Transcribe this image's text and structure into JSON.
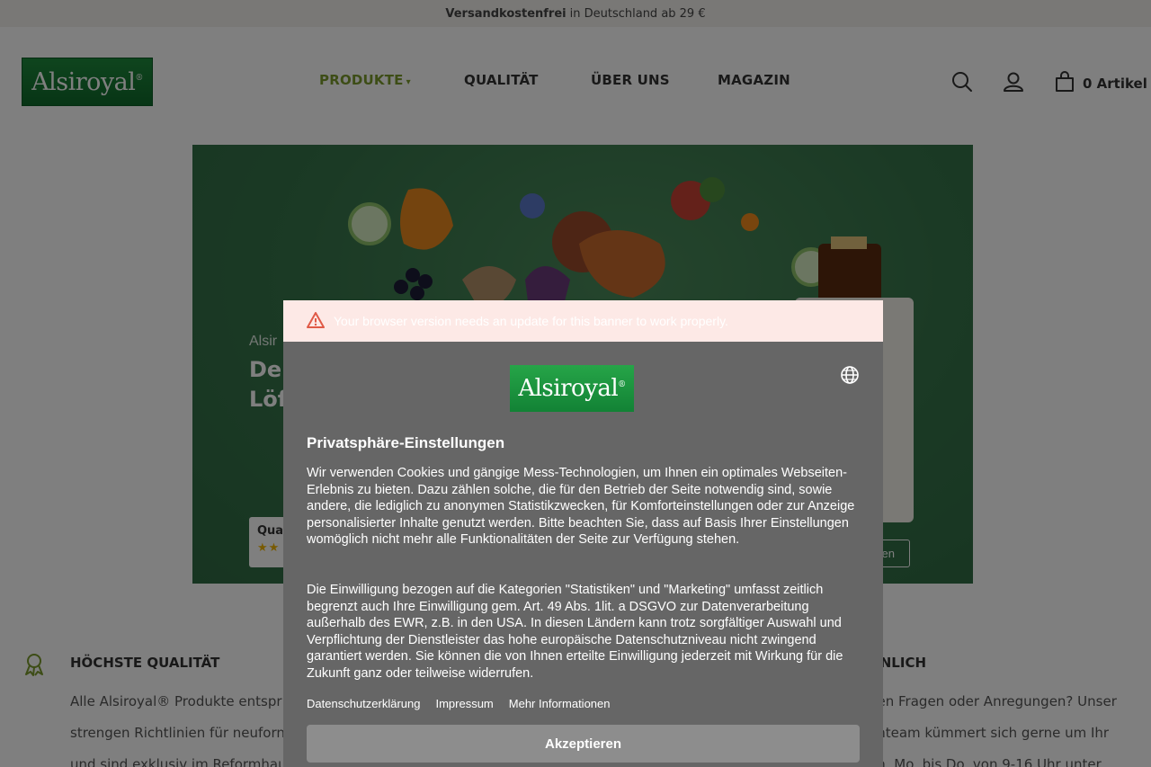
{
  "promo": {
    "bold": "Versandkostenfrei",
    "rest": "in Deutschland ab 29 €"
  },
  "header": {
    "logo_text": "Alsiroyal",
    "logo_reg": "®",
    "nav": [
      {
        "label": "PRODUKTE",
        "active": true,
        "caret": "▾"
      },
      {
        "label": "QUALITÄT"
      },
      {
        "label": "ÜBER UNS"
      },
      {
        "label": "MAGAZIN"
      }
    ],
    "icons": [
      "search-icon",
      "user-icon",
      "bag-icon"
    ],
    "cart_label": "0 Artikel"
  },
  "hero": {
    "small": "Alsir",
    "title_line1": "Der",
    "title_line2": "Löf",
    "badge_text": "Qua",
    "badge_stars": "★★",
    "button_label": "en"
  },
  "features": [
    {
      "title": "HÖCHSTE QUALITÄT",
      "lines": [
        "Alle Alsiroyal® Produkte entspr",
        "strengen Richtlinien für neuforn",
        "und sind exklusiv im Reformhau"
      ],
      "icon": "award-icon"
    },
    {
      "title": "ÖNLICH",
      "lines": [
        "ben Fragen oder Anregungen? Unser",
        "enteam kümmert sich gerne um Ihr",
        "en. Mo. bis Do. von 9-16 Uhr unter"
      ]
    }
  ],
  "colors": {
    "brand_green": "#1e8a3c",
    "nav_active": "#7a9a2c",
    "warn_bg": "#fde9e6"
  },
  "consent": {
    "warning": "Your browser version needs an update for this banner to work properly.",
    "logo_text": "Alsiroyal",
    "logo_reg": "®",
    "title": "Privatsphäre-Einstellungen",
    "p1": "Wir verwenden Cookies und gängige Mess-Technologien, um Ihnen ein optimales Webseiten-Erlebnis zu bieten. Dazu zählen solche, die für den Betrieb der Seite notwendig sind, sowie andere, die lediglich zu anonymen Statistikzwecken, für Komforteinstellungen oder zur Anzeige personalisierter Inhalte genutzt werden. Bitte beachten Sie, dass auf Basis Ihrer Einstellungen womöglich nicht mehr alle Funktionalitäten der Seite zur Verfügung stehen.",
    "p2": "Die Einwilligung bezogen auf die Kategorien \"Statistiken\" und \"Marketing\" umfasst zeitlich begrenzt auch Ihre Einwilligung gem. Art. 49 Abs. 1lit. a DSGVO zur Datenverarbeitung außerhalb des EWR, z.B. in den USA. In diesen Ländern kann trotz sorgfältiger Auswahl und Verpflichtung der Dienstleister das hohe europäische Datenschutzniveau nicht zwingend garantiert werden. Sie können die von Ihnen erteilte Einwilligung jederzeit mit Wirkung für die Zukunft ganz oder teilweise widerrufen.",
    "links": [
      "Datenschutzerklärung",
      "Impressum",
      "Mehr Informationen"
    ],
    "accept_label": "Akzeptieren"
  }
}
